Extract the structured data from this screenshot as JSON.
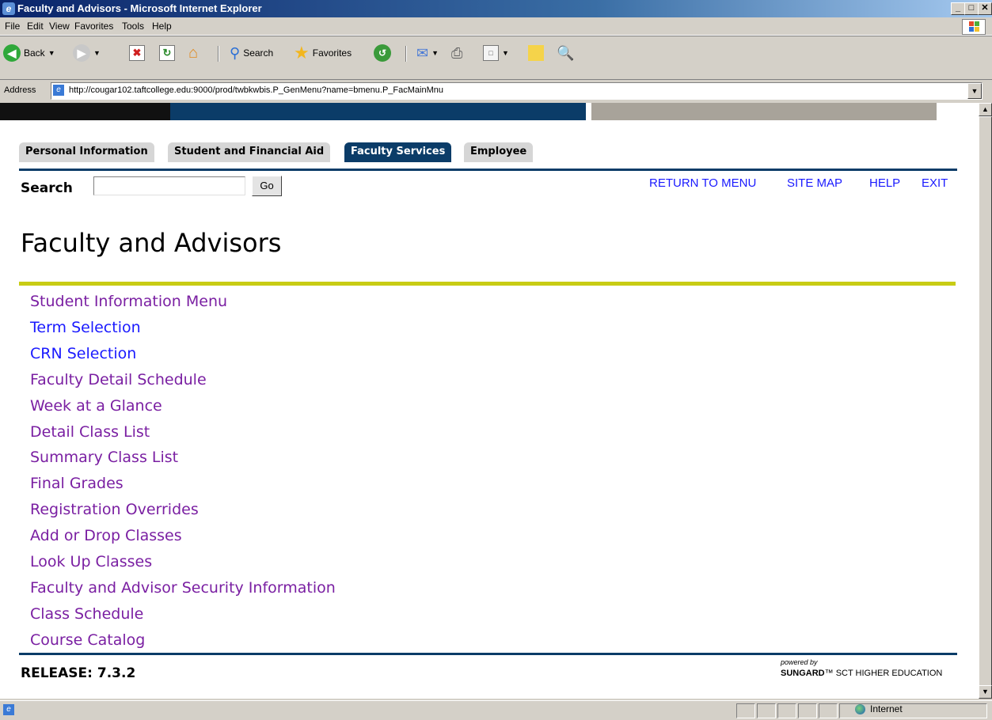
{
  "window": {
    "title": "Faculty and Advisors - Microsoft Internet Explorer",
    "controls": {
      "minimize": "_",
      "maximize": "□",
      "close": "✕"
    }
  },
  "menubar": {
    "items": [
      "File",
      "Edit",
      "View",
      "Favorites",
      "Tools",
      "Help"
    ]
  },
  "toolbar": {
    "back_label": "Back",
    "search_label": "Search",
    "favorites_label": "Favorites"
  },
  "address": {
    "label": "Address",
    "url": "http://cougar102.taftcollege.edu:9000/prod/twbkwbis.P_GenMenu?name=bmenu.P_FacMainMnu"
  },
  "tabs": [
    {
      "label": "Personal Information",
      "active": false
    },
    {
      "label": "Student and Financial Aid",
      "active": false
    },
    {
      "label": "Faculty Services",
      "active": true
    },
    {
      "label": "Employee",
      "active": false
    }
  ],
  "search": {
    "label": "Search",
    "value": "",
    "go_label": "Go"
  },
  "top_links": [
    "RETURN TO MENU",
    "SITE MAP",
    "HELP",
    "EXIT"
  ],
  "page_title": "Faculty and Advisors",
  "menu_links": [
    {
      "label": "Student Information Menu",
      "visited": true
    },
    {
      "label": "Term Selection",
      "visited": false
    },
    {
      "label": "CRN Selection",
      "visited": false
    },
    {
      "label": "Faculty Detail Schedule",
      "visited": true
    },
    {
      "label": "Week at a Glance",
      "visited": true
    },
    {
      "label": "Detail Class List",
      "visited": true
    },
    {
      "label": "Summary Class List",
      "visited": true
    },
    {
      "label": "Final Grades",
      "visited": true
    },
    {
      "label": "Registration Overrides",
      "visited": true
    },
    {
      "label": "Add or Drop Classes",
      "visited": true
    },
    {
      "label": "Look Up Classes",
      "visited": true
    },
    {
      "label": "Faculty and Advisor Security Information",
      "visited": true
    },
    {
      "label": "Class Schedule",
      "visited": true
    },
    {
      "label": "Course Catalog",
      "visited": true
    }
  ],
  "footer": {
    "release": "RELEASE: 7.3.2",
    "powered_by": "powered by",
    "brand": "SUNGARD",
    "brand_suffix": "SCT HIGHER EDUCATION"
  },
  "statusbar": {
    "zone": "Internet"
  },
  "colors": {
    "navy": "#0b3c68",
    "accent_line": "#c8cc14",
    "link": "#1a1aff",
    "visited_link": "#7a1fa2"
  }
}
